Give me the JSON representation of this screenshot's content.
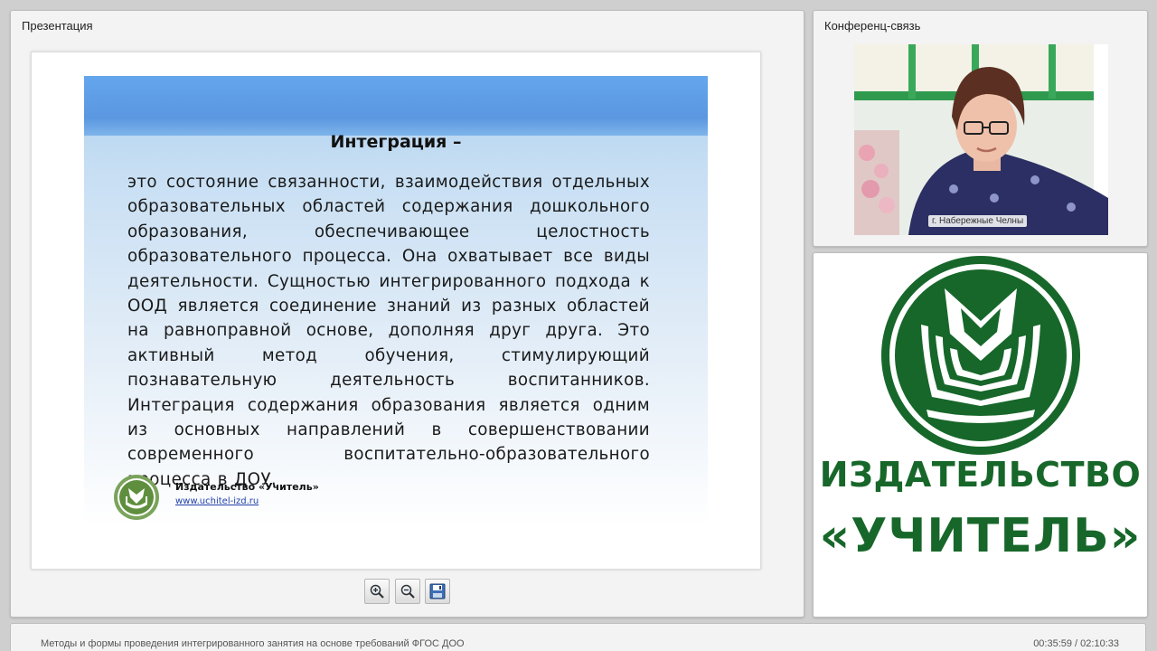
{
  "presentation_panel": {
    "title": "Презентация",
    "slide": {
      "heading": "Интеграция –",
      "body": "это состояние связанности, взаимодействия отдельных образовательных областей содержания дошкольного образования, обеспечивающее целостность образовательного процесса. Она охватывает все виды деятельности. Сущностью интегрированного подхода к ООД является соединение знаний из разных областей на равноправной основе, дополняя друг друга. Это активный метод обучения, стимулирующий познавательную деятельность воспитанников. Интеграция содержания образования является одним из основных направлений в совершенствовании современного воспитательно-образовательного процесса в ДОУ.",
      "publisher": "Издательство «Учитель»",
      "url": "www.uchitel-izd.ru"
    },
    "toolbar": {
      "zoom_in_icon": "magnifier-plus-icon",
      "zoom_out_icon": "magnifier-minus-icon",
      "save_icon": "floppy-disk-icon"
    }
  },
  "conference_panel": {
    "title": "Конференц-связь",
    "video_caption": "г. Набережные Челны"
  },
  "logo_panel": {
    "line1": "ИЗДАТЕЛЬСТВО",
    "line2": "«УЧИТЕЛЬ»"
  },
  "footer": {
    "title": "Методы и формы проведения интегрированного занятия на основе требований ФГОС ДОО",
    "time": "00:35:59 / 02:10:33"
  },
  "colors": {
    "brand_green": "#17672a",
    "slide_band": "#5a97e0"
  }
}
